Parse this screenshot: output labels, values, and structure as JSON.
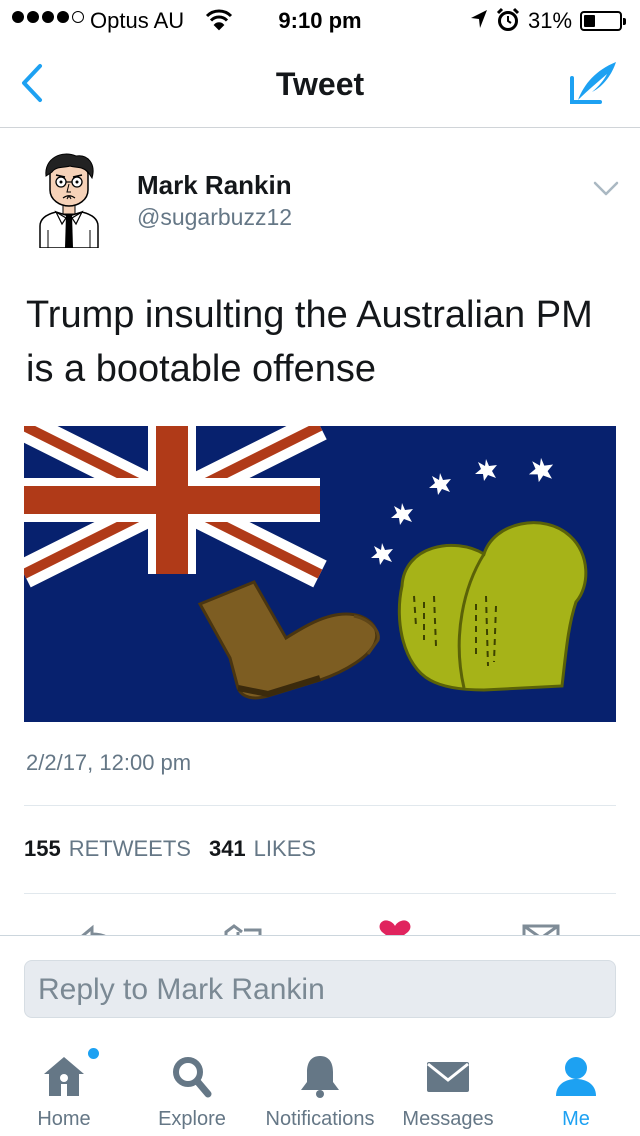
{
  "status_bar": {
    "carrier": "Optus AU",
    "time": "9:10 pm",
    "battery": "31%",
    "battery_level": 0.31
  },
  "nav": {
    "title": "Tweet"
  },
  "tweet": {
    "author_name": "Mark Rankin",
    "author_handle": "@sugarbuzz12",
    "text_line1": "Trump insulting the Australian PM",
    "text_line2": "is a bootable offense",
    "timestamp": "2/2/17, 12:00 pm",
    "retweets_count": "155",
    "retweets_label": "RETWEETS",
    "likes_count": "341",
    "likes_label": "LIKES"
  },
  "reply": {
    "placeholder": "Reply to Mark Rankin"
  },
  "tabs": [
    {
      "label": "Home",
      "icon": "home-icon"
    },
    {
      "label": "Explore",
      "icon": "search-icon"
    },
    {
      "label": "Notifications",
      "icon": "bell-icon"
    },
    {
      "label": "Messages",
      "icon": "envelope-icon"
    },
    {
      "label": "Me",
      "icon": "person-icon"
    }
  ],
  "colors": {
    "accent": "#1da1f2",
    "flag_blue": "#07216e",
    "flag_red": "#b03a18",
    "boot": "#7d5d22",
    "bottom": "#a6b318"
  }
}
